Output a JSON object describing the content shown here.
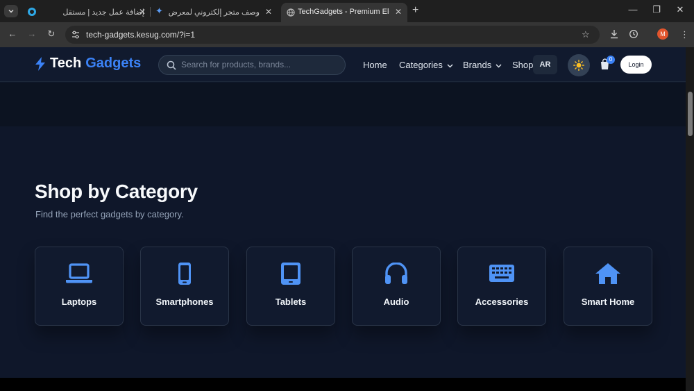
{
  "browser": {
    "tabs": [
      {
        "title": "إضافة عمل جديد | مستقل",
        "active": false
      },
      {
        "title": "وصف متجر إلكتروني لمعرض الأ...",
        "active": false
      },
      {
        "title": "TechGadgets - Premium Electro",
        "active": true
      }
    ],
    "url": "tech-gadgets.kesug.com/?i=1",
    "profile_initial": "M"
  },
  "header": {
    "logo_word1": "Tech",
    "logo_word2": "Gadgets",
    "search_placeholder": "Search for products, brands...",
    "nav": {
      "home": "Home",
      "categories": "Categories",
      "brands": "Brands",
      "shop": "Shop"
    },
    "lang": "AR",
    "cart_count": "0",
    "login": "Login"
  },
  "section": {
    "title": "Shop by Category",
    "subtitle": "Find the perfect gadgets by category.",
    "categories": [
      {
        "label": "Laptops",
        "icon": "laptop-icon"
      },
      {
        "label": "Smartphones",
        "icon": "smartphone-icon"
      },
      {
        "label": "Tablets",
        "icon": "tablet-icon"
      },
      {
        "label": "Audio",
        "icon": "headphones-icon"
      },
      {
        "label": "Accessories",
        "icon": "keyboard-icon"
      },
      {
        "label": "Smart Home",
        "icon": "home-icon"
      }
    ]
  },
  "colors": {
    "accent": "#3b82f6",
    "page_bg": "#0f172a",
    "header_bg": "#111a2e"
  }
}
